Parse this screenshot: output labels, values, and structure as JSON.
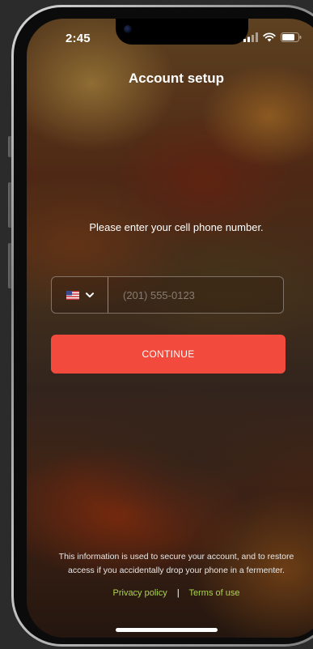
{
  "status_bar": {
    "time": "2:45"
  },
  "header": {
    "title": "Account setup"
  },
  "prompt": {
    "text": "Please enter your cell phone number."
  },
  "phone_input": {
    "country_icon": "us-flag-icon",
    "placeholder": "(201) 555-0123",
    "value": ""
  },
  "continue_button": {
    "label": "CONTINUE"
  },
  "footer": {
    "info_line1": "This information is used to secure your account, and to restore",
    "info_line2": "access if you accidentally drop your phone in a fermenter.",
    "privacy_label": "Privacy policy",
    "separator": "|",
    "terms_label": "Terms of use"
  },
  "colors": {
    "accent": "#f24a3c",
    "link": "#a8d54a",
    "text": "#ffffff"
  }
}
